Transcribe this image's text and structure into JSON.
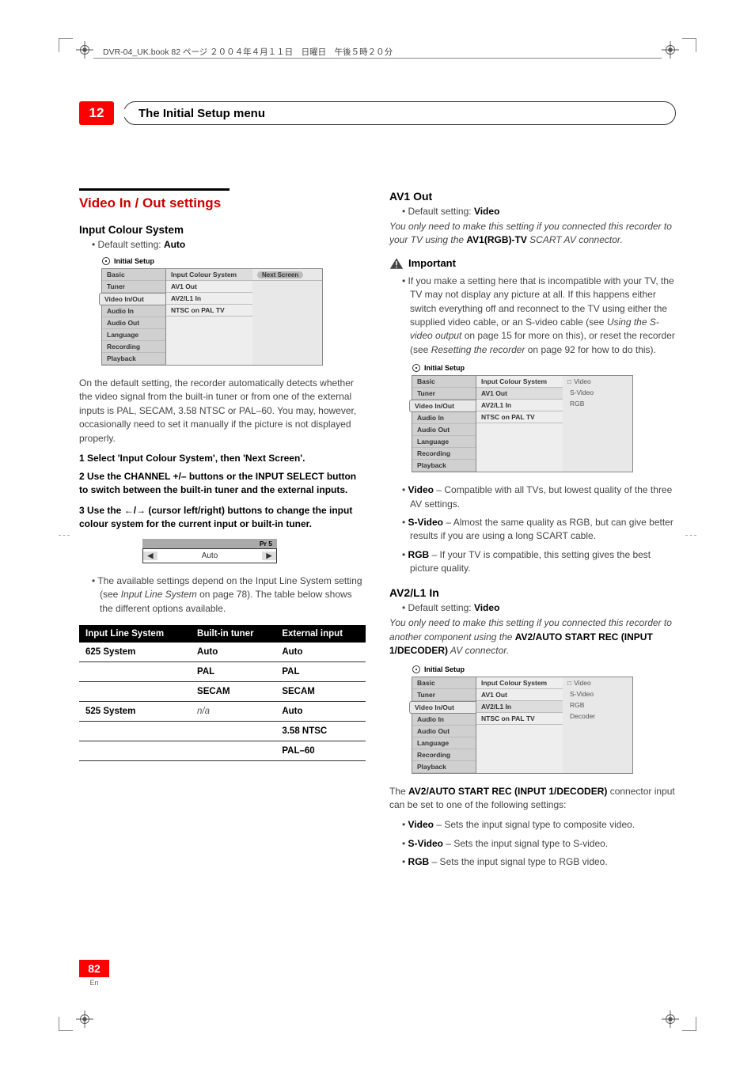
{
  "collation_note": "DVR-04_UK.book  82 ページ  ２００４年４月１１日　日曜日　午後５時２０分",
  "chapter": {
    "number": "12",
    "title": "The Initial Setup menu"
  },
  "left": {
    "section_head": "Video In / Out settings",
    "input_colour_system": {
      "heading": "Input Colour System",
      "default_prefix": "Default setting: ",
      "default_value": "Auto",
      "menu": {
        "caption": "Initial Setup",
        "left_items": [
          "Basic",
          "Tuner",
          "Video In/Out",
          "Audio In",
          "Audio Out",
          "Language",
          "Recording",
          "Playback"
        ],
        "tab_index": 2,
        "mid_items": [
          "Input Colour System",
          "AV1 Out",
          "AV2/L1 In",
          "NTSC on PAL TV"
        ],
        "mid_highlight": 0,
        "right_label": "Next Screen"
      },
      "para1": "On the default setting, the recorder automatically detects whether the video signal from the built-in tuner or from one of the external inputs is PAL, SECAM, 3.58 NTSC or PAL–60. You may, however, occasionally need to set it manually if the picture is not displayed properly.",
      "step1": "1    Select 'Input Colour System', then 'Next Screen'.",
      "step2a": "2    Use the CHANNEL +/– buttons or the INPUT SELECT button to switch between the built-in tuner and the external inputs.",
      "step3a": "3    Use the  ←/→  (cursor left/right) buttons to change the input colour system for the current input or built-in tuner.",
      "spinner": {
        "top": "Pr 5",
        "value": "Auto"
      },
      "avail_prefix": "The available settings depend on the Input Line System setting (see ",
      "avail_em": "Input Line System",
      "avail_mid": " on page 78). The table below shows the different options available.",
      "table": {
        "headers": [
          "Input Line System",
          "Built-in tuner",
          "External input"
        ],
        "rows": [
          [
            "625 System",
            "Auto",
            "Auto"
          ],
          [
            "",
            "PAL",
            "PAL"
          ],
          [
            "",
            "SECAM",
            "SECAM"
          ],
          [
            "525 System",
            "n/a",
            "Auto"
          ],
          [
            "",
            "",
            "3.58 NTSC"
          ],
          [
            "",
            "",
            "PAL–60"
          ]
        ]
      }
    }
  },
  "right": {
    "av1": {
      "heading": "AV1 Out",
      "default_prefix": "Default setting: ",
      "default_value": "Video",
      "note_em": "You only need to make this setting if you connected this recorder to your TV using the ",
      "note_bold": "AV1(RGB)-TV",
      "note_em2": " SCART AV connector.",
      "important_label": "Important",
      "important_text_1": "If you make a setting here that is incompatible with your TV, the TV may not display any picture at all. If this happens either switch everything off and reconnect to the TV using either the supplied video cable, or an S-video cable (see ",
      "important_em1": "Using the S-video output",
      "important_text_2": " on page 15 for more on this), or reset the recorder (see ",
      "important_em2": "Resetting the recorder",
      "important_text_3": " on page 92 for how to do this).",
      "menu": {
        "caption": "Initial Setup",
        "left_items": [
          "Basic",
          "Tuner",
          "Video In/Out",
          "Audio In",
          "Audio Out",
          "Language",
          "Recording",
          "Playback"
        ],
        "tab_index": 2,
        "mid_items": [
          "Input Colour System",
          "AV1 Out",
          "AV2/L1 In",
          "NTSC on PAL TV"
        ],
        "mid_highlight": 1,
        "right_opts": [
          "Video",
          "S-Video",
          "RGB"
        ],
        "right_sel": 0
      },
      "bullets": [
        {
          "b": "Video",
          "t": " – Compatible with all TVs, but lowest quality of the three AV settings."
        },
        {
          "b": "S-Video",
          "t": " – Almost the same quality as RGB, but can give better results if you are using a long SCART cable."
        },
        {
          "b": "RGB",
          "t": " – If your TV is compatible, this setting gives the best picture quality."
        }
      ]
    },
    "av2": {
      "heading": "AV2/L1 In",
      "default_prefix": "Default setting: ",
      "default_value": "Video",
      "note_em": "You only need to make this setting if you connected this recorder to another component using the ",
      "note_bold": "AV2/AUTO START REC (INPUT 1/DECODER)",
      "note_em2": " AV connector.",
      "menu": {
        "caption": "Initial Setup",
        "left_items": [
          "Basic",
          "Tuner",
          "Video In/Out",
          "Audio In",
          "Audio Out",
          "Language",
          "Recording",
          "Playback"
        ],
        "tab_index": 2,
        "mid_items": [
          "Input Colour System",
          "AV1 Out",
          "AV2/L1 In",
          "NTSC on PAL TV"
        ],
        "mid_highlight": 2,
        "right_opts": [
          "Video",
          "S-Video",
          "RGB",
          "Decoder"
        ],
        "right_sel": 0
      },
      "after_prefix": "The ",
      "after_bold": "AV2/AUTO START REC (INPUT 1/DECODER)",
      "after_text": " connector input can be set to one of the following settings:",
      "bullets": [
        {
          "b": "Video",
          "t": " – Sets the input signal type to composite video."
        },
        {
          "b": "S-Video",
          "t": " – Sets the input signal type to S-video."
        },
        {
          "b": "RGB",
          "t": " – Sets the input signal type to RGB video."
        }
      ]
    }
  },
  "page": {
    "number": "82",
    "lang": "En"
  }
}
